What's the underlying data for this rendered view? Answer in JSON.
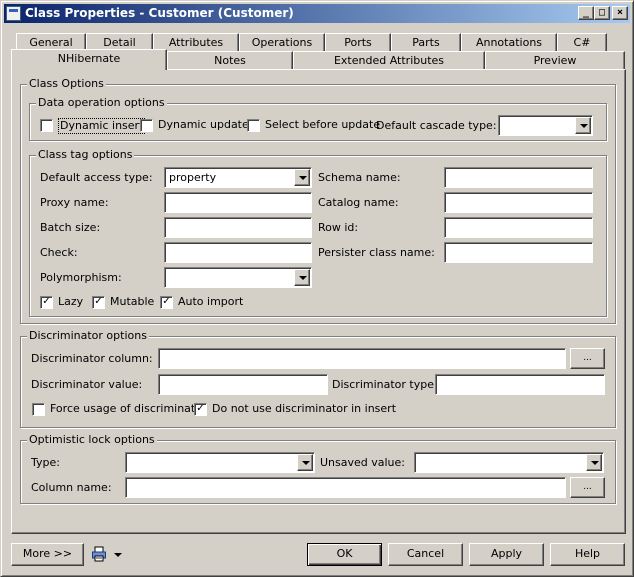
{
  "window": {
    "title": "Class Properties - Customer (Customer)",
    "min_glyph": "_",
    "max_glyph": "□",
    "close_glyph": "×"
  },
  "tabs_row1": [
    "General",
    "Detail",
    "Attributes",
    "Operations",
    "Ports",
    "Parts",
    "Annotations",
    "C#"
  ],
  "tabs_row2": [
    "NHibernate",
    "Notes",
    "Extended Attributes",
    "Preview"
  ],
  "active_tab": "NHibernate",
  "class_options": {
    "legend": "Class Options",
    "data_operation": {
      "legend": "Data operation options",
      "dynamic_insert": {
        "label": "Dynamic insert",
        "checked": false
      },
      "dynamic_update": {
        "label": "Dynamic update",
        "checked": false
      },
      "select_before_update": {
        "label": "Select before update",
        "checked": false
      },
      "default_cascade_type": {
        "label": "Default cascade type:",
        "value": ""
      }
    },
    "class_tag": {
      "legend": "Class tag options",
      "default_access_type": {
        "label": "Default access type:",
        "value": "property"
      },
      "proxy_name": {
        "label": "Proxy name:",
        "value": ""
      },
      "batch_size": {
        "label": "Batch size:",
        "value": ""
      },
      "check": {
        "label": "Check:",
        "value": ""
      },
      "polymorphism": {
        "label": "Polymorphism:",
        "value": ""
      },
      "schema_name": {
        "label": "Schema name:",
        "value": ""
      },
      "catalog_name": {
        "label": "Catalog name:",
        "value": ""
      },
      "row_id": {
        "label": "Row id:",
        "value": ""
      },
      "persister_class_name": {
        "label": "Persister class name:",
        "value": ""
      },
      "lazy": {
        "label": "Lazy",
        "checked": true
      },
      "mutable": {
        "label": "Mutable",
        "checked": true
      },
      "auto_import": {
        "label": "Auto import",
        "checked": true
      }
    }
  },
  "discriminator": {
    "legend": "Discriminator options",
    "column": {
      "label": "Discriminator column:",
      "value": ""
    },
    "value": {
      "label": "Discriminator value:",
      "value": ""
    },
    "type": {
      "label": "Discriminator type:",
      "value": ""
    },
    "force_usage": {
      "label": "Force usage of discriminator",
      "checked": false
    },
    "no_insert": {
      "label": "Do not use discriminator in insert",
      "checked": true
    },
    "browse_label": "..."
  },
  "optimistic_lock": {
    "legend": "Optimistic lock options",
    "type": {
      "label": "Type:",
      "value": ""
    },
    "unsaved_value": {
      "label": "Unsaved value:",
      "value": ""
    },
    "column_name": {
      "label": "Column name:",
      "value": ""
    },
    "browse_label": "..."
  },
  "footer": {
    "more": "More >>",
    "ok": "OK",
    "cancel": "Cancel",
    "apply": "Apply",
    "help": "Help"
  },
  "check_glyph": "✓",
  "colors": {
    "face": "#d4d0c8",
    "title_start": "#0a246a",
    "title_end": "#a6caf0"
  }
}
